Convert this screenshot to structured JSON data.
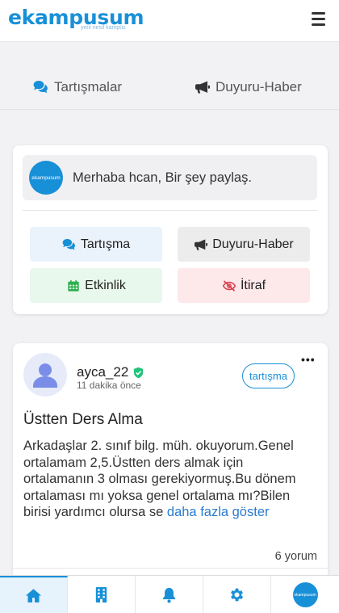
{
  "header": {
    "logo_main": "ekampusum",
    "logo_sub": "yeni nesil kampüs"
  },
  "tabs": {
    "discussions": "Tartışmalar",
    "announcements": "Duyuru-Haber"
  },
  "composer": {
    "avatar_text": "ekampusum",
    "prompt": "Merhaba hcan, Bir şey paylaş.",
    "buttons": {
      "discussion": "Tartışma",
      "announcement": "Duyuru-Haber",
      "event": "Etkinlik",
      "confession": "İtiraf"
    }
  },
  "post": {
    "username": "ayca_22",
    "time": "11 dakika önce",
    "badge": "tartışma",
    "title": "Üstten Ders Alma",
    "body": "Arkadaşlar 2. sınıf bilg. müh. okuyorum.Genel ortalamam 2,5.Üstten ders almak için ortalamanın 3 olması gerekiyormuş.Bu dönem ortalaması mı yoksa genel ortalama mı?Bilen birisi yardımcı olursa se",
    "show_more": "daha fazla göster",
    "comments": "6 yorum"
  },
  "bottom_nav": {
    "profile_avatar_text": "ekampusum"
  },
  "colors": {
    "brand": "#1890d8",
    "discussion_bg": "#eaf3fc",
    "announcement_bg": "#ececec",
    "event_bg": "#e9f8ec",
    "confession_bg": "#fde8ea",
    "event_icon": "#2eb04f",
    "confession_icon": "#d93b4a",
    "verified": "#22c47a"
  }
}
